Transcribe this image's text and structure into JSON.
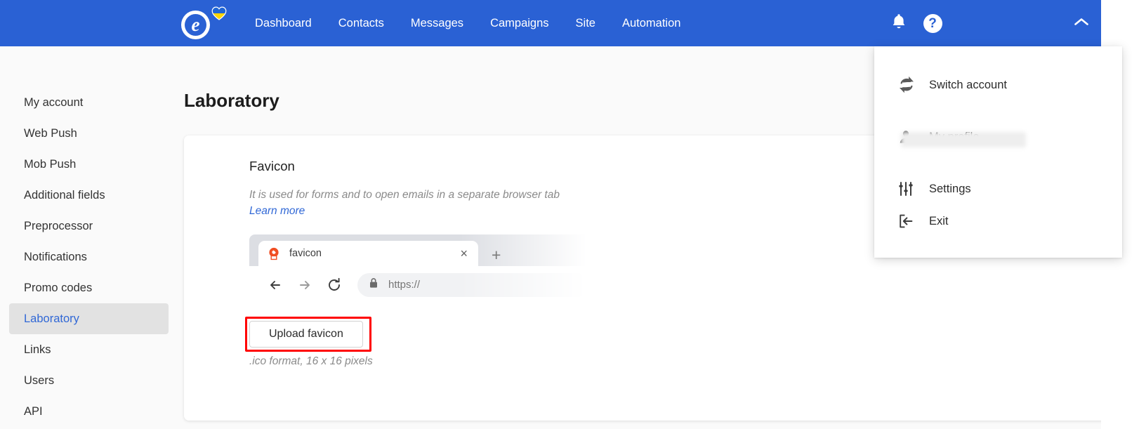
{
  "brand": {
    "logo_letter": "e",
    "logo_name": "esputnik-logo",
    "accent_blue": "#2a61d4",
    "heart_colors": [
      "#1f66d6",
      "#ffd500"
    ]
  },
  "topnav": {
    "items": [
      {
        "label": "Dashboard"
      },
      {
        "label": "Contacts"
      },
      {
        "label": "Messages"
      },
      {
        "label": "Campaigns"
      },
      {
        "label": "Site"
      },
      {
        "label": "Automation"
      }
    ],
    "notifications_icon": "bell-icon",
    "help_icon": "help-icon",
    "help_glyph": "?",
    "account_toggle_icon": "chevron-up-icon"
  },
  "account_menu": {
    "items": [
      {
        "label": "Switch account",
        "icon": "switch-account-icon"
      },
      {
        "label": "My profile",
        "icon": "user-icon"
      },
      {
        "label": "Settings",
        "icon": "sliders-icon"
      },
      {
        "label": "Exit",
        "icon": "logout-icon"
      }
    ],
    "profile_value_redacted": ""
  },
  "sidebar": {
    "items": [
      {
        "label": "My account",
        "active": false
      },
      {
        "label": "Web Push",
        "active": false
      },
      {
        "label": "Mob Push",
        "active": false
      },
      {
        "label": "Additional fields",
        "active": false
      },
      {
        "label": "Preprocessor",
        "active": false
      },
      {
        "label": "Notifications",
        "active": false
      },
      {
        "label": "Promo codes",
        "active": false
      },
      {
        "label": "Laboratory",
        "active": true
      },
      {
        "label": "Links",
        "active": false
      },
      {
        "label": "Users",
        "active": false
      },
      {
        "label": "API",
        "active": false
      }
    ],
    "active_color": "#3168d6",
    "active_bg": "#e2e2e2"
  },
  "page": {
    "title": "Laboratory"
  },
  "favicon_card": {
    "title": "Favicon",
    "description": "It is used for forms and to open emails in a separate browser tab",
    "learn_more": "Learn more",
    "upload_button": "Upload favicon",
    "upload_hint": ".ico format, 16 x 16 pixels",
    "annotation_color": "#ff0000"
  },
  "browser_preview": {
    "tab_title": "favicon",
    "tab_favicon_icon": "site-favicon-icon",
    "tab_favicon_color": "#f04e23",
    "close_glyph": "×",
    "new_tab_glyph": "+",
    "back_icon": "arrow-left-icon",
    "forward_icon": "arrow-right-icon",
    "reload_icon": "reload-icon",
    "lock_icon": "lock-icon",
    "url_text": "https://"
  }
}
